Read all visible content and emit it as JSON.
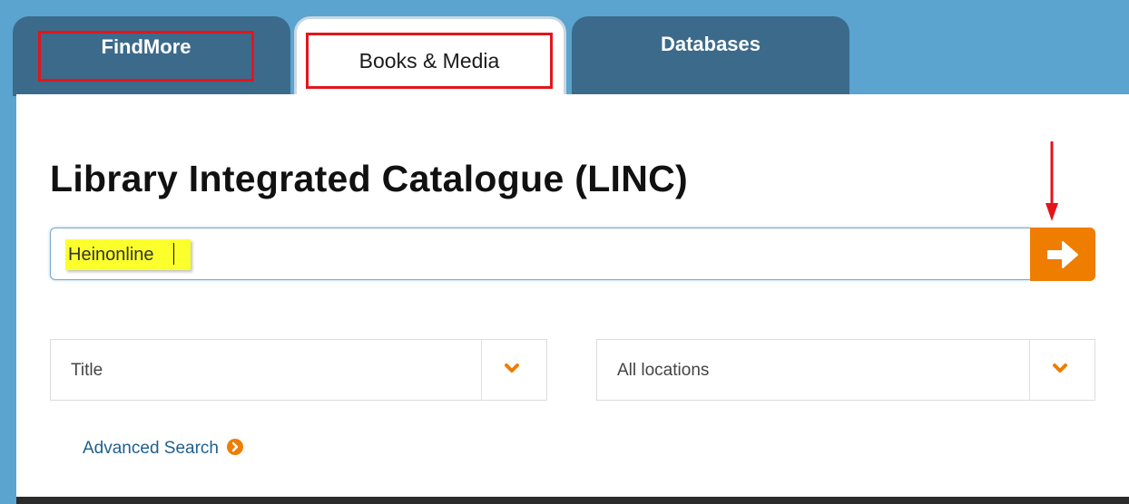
{
  "tabs": [
    {
      "label": "FindMore",
      "active": false
    },
    {
      "label": "Books & Media",
      "active": true
    },
    {
      "label": "Databases",
      "active": false
    }
  ],
  "heading": "Library Integrated Catalogue (LINC)",
  "search": {
    "value": "Heinonline",
    "submit_icon": "arrow-right-icon"
  },
  "filters": {
    "field": {
      "selected": "Title"
    },
    "location": {
      "selected": "All locations"
    }
  },
  "advanced_search": {
    "label": "Advanced Search",
    "icon": "circle-chevron-right-icon"
  },
  "colors": {
    "accent": "#ef7d00",
    "tab_inactive": "#3c6a8b",
    "background": "#5aa4cf",
    "annotation": "#e3151b",
    "highlight": "#fbff2b",
    "link": "#1f5f8f"
  }
}
